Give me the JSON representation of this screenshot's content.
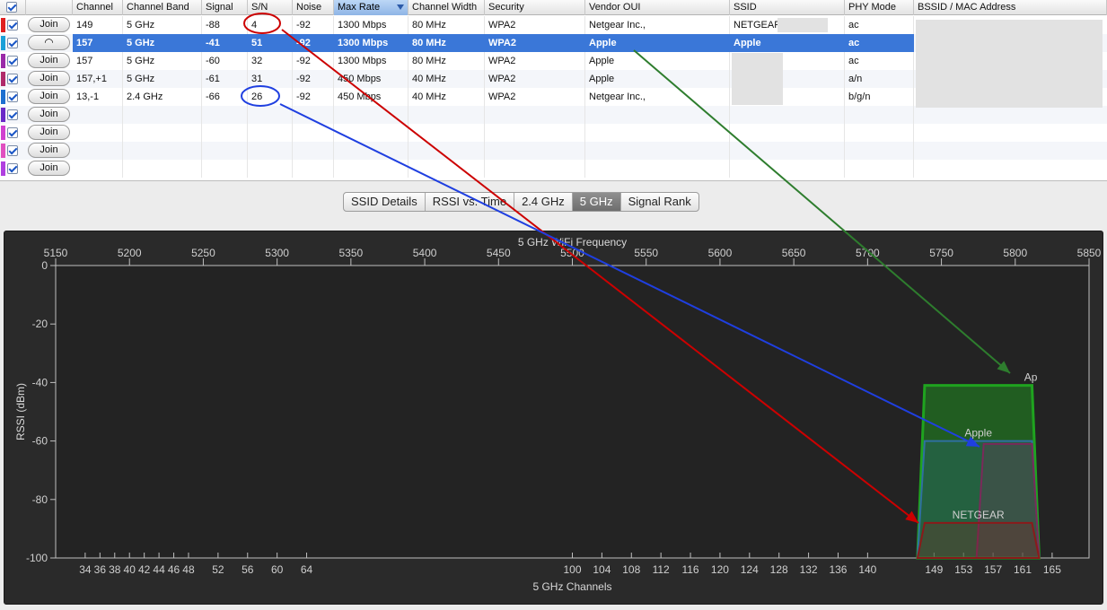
{
  "table": {
    "columns": [
      "Channel",
      "Channel Band",
      "Signal",
      "S/N",
      "Noise",
      "Max Rate",
      "Channel Width",
      "Security",
      "Vendor OUI",
      "SSID",
      "PHY Mode",
      "BSSID / MAC Address"
    ],
    "sorted_column": "Max Rate",
    "join_label": "Join",
    "rows": [
      {
        "color": "#e02020",
        "channel": "149",
        "band": "5 GHz",
        "signal": "-88",
        "sn": "4",
        "noise": "-92",
        "rate": "1300 Mbps",
        "width": "80 MHz",
        "security": "WPA2",
        "vendor": "Netgear Inc.,",
        "ssid": "NETGEAR",
        "phy": "ac",
        "selected": false,
        "connected": false
      },
      {
        "color": "#1aa0d8",
        "channel": "157",
        "band": "5 GHz",
        "signal": "-41",
        "sn": "51",
        "noise": "-92",
        "rate": "1300 Mbps",
        "width": "80 MHz",
        "security": "WPA2",
        "vendor": "Apple",
        "ssid": "Apple",
        "phy": "ac",
        "selected": true,
        "connected": true
      },
      {
        "color": "#9a2aa8",
        "channel": "157",
        "band": "5 GHz",
        "signal": "-60",
        "sn": "32",
        "noise": "-92",
        "rate": "1300 Mbps",
        "width": "80 MHz",
        "security": "WPA2",
        "vendor": "Apple",
        "ssid": "",
        "phy": "ac",
        "selected": false,
        "connected": false
      },
      {
        "color": "#b02a6a",
        "channel": "157,+1",
        "band": "5 GHz",
        "signal": "-61",
        "sn": "31",
        "noise": "-92",
        "rate": "450 Mbps",
        "width": "40 MHz",
        "security": "WPA2",
        "vendor": "Apple",
        "ssid": "",
        "phy": "a/n",
        "selected": false,
        "connected": false
      },
      {
        "color": "#1e6fd0",
        "channel": "13,-1",
        "band": "2.4 GHz",
        "signal": "-66",
        "sn": "26",
        "noise": "-92",
        "rate": "450 Mbps",
        "width": "40 MHz",
        "security": "WPA2",
        "vendor": "Netgear Inc.,",
        "ssid": "",
        "phy": "b/g/n",
        "selected": false,
        "connected": false
      },
      {
        "color": "#6a2ac8",
        "channel": "",
        "band": "",
        "signal": "",
        "sn": "",
        "noise": "",
        "rate": "",
        "width": "",
        "security": "",
        "vendor": "",
        "ssid": "",
        "phy": "",
        "selected": false,
        "connected": false
      },
      {
        "color": "#d040d0",
        "channel": "",
        "band": "",
        "signal": "",
        "sn": "",
        "noise": "",
        "rate": "",
        "width": "",
        "security": "",
        "vendor": "",
        "ssid": "",
        "phy": "",
        "selected": false,
        "connected": false
      },
      {
        "color": "#e050c0",
        "channel": "",
        "band": "",
        "signal": "",
        "sn": "",
        "noise": "",
        "rate": "",
        "width": "",
        "security": "",
        "vendor": "",
        "ssid": "",
        "phy": "",
        "selected": false,
        "connected": false
      },
      {
        "color": "#b040e0",
        "channel": "",
        "band": "",
        "signal": "",
        "sn": "",
        "noise": "",
        "rate": "",
        "width": "",
        "security": "",
        "vendor": "",
        "ssid": "",
        "phy": "",
        "selected": false,
        "connected": false
      }
    ]
  },
  "tabs": [
    {
      "label": "SSID Details",
      "active": false
    },
    {
      "label": "RSSI vs. Time",
      "active": false
    },
    {
      "label": "2.4 GHz",
      "active": false
    },
    {
      "label": "5 GHz",
      "active": true
    },
    {
      "label": "Signal Rank",
      "active": false
    }
  ],
  "annotation_colors": {
    "red": "#cc0000",
    "blue": "#1f3fe0",
    "green": "#2e7d2e"
  },
  "chart_data": {
    "type": "area",
    "title": "5 GHz WiFi Frequency",
    "xlabel": "5 GHz Channels",
    "ylabel": "RSSI (dBm)",
    "freq_ticks": [
      5150,
      5200,
      5250,
      5300,
      5350,
      5400,
      5450,
      5500,
      5550,
      5600,
      5650,
      5700,
      5750,
      5800,
      5850
    ],
    "xlim": [
      5150,
      5850
    ],
    "ylim": [
      -100,
      0
    ],
    "y_ticks": [
      0,
      -20,
      -40,
      -60,
      -80,
      -100
    ],
    "channel_ticks": [
      "34",
      "36",
      "38",
      "40",
      "42",
      "44",
      "46",
      "48",
      "52",
      "56",
      "60",
      "64",
      "100",
      "104",
      "108",
      "112",
      "116",
      "120",
      "124",
      "128",
      "132",
      "136",
      "140",
      "149",
      "153",
      "157",
      "161",
      "165"
    ],
    "series": [
      {
        "name": "Ap",
        "center_channel": 155,
        "width_mhz": 80,
        "rssi": -41,
        "color": "#1fa31f"
      },
      {
        "name": "Apple",
        "center_channel": 155,
        "width_mhz": 80,
        "rssi": -60,
        "color": "#2f6fa0"
      },
      {
        "name": "",
        "center_channel": 159,
        "width_mhz": 40,
        "rssi": -61,
        "color": "#7a2a5a"
      },
      {
        "name": "NETGEAR",
        "center_channel": 155,
        "width_mhz": 80,
        "rssi": -88,
        "color": "#8a1a1a"
      }
    ]
  }
}
